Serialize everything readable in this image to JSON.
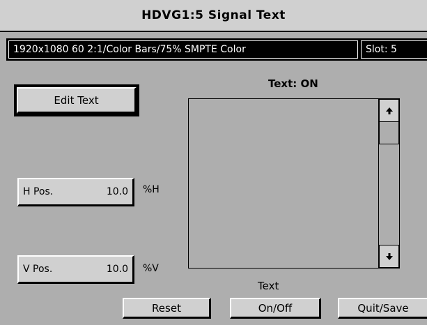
{
  "title": "HDVG1:5  Signal Text",
  "status": {
    "format": "1920x1080  60 2:1/Color Bars/75% SMPTE  Color",
    "slot": "Slot: 5"
  },
  "edit_text_label": "Edit Text",
  "h_pos": {
    "label": "H Pos.",
    "value": "10.0",
    "unit": "%H"
  },
  "v_pos": {
    "label": "V Pos.",
    "value": "10.0",
    "unit": "%V"
  },
  "text_status": "Text: ON",
  "text_label": "Text",
  "buttons": {
    "reset": "Reset",
    "onoff": "On/Off",
    "quit": "Quit/Save"
  },
  "icons": {
    "scroll_up": "arrow-up-icon",
    "scroll_down": "arrow-down-icon"
  }
}
